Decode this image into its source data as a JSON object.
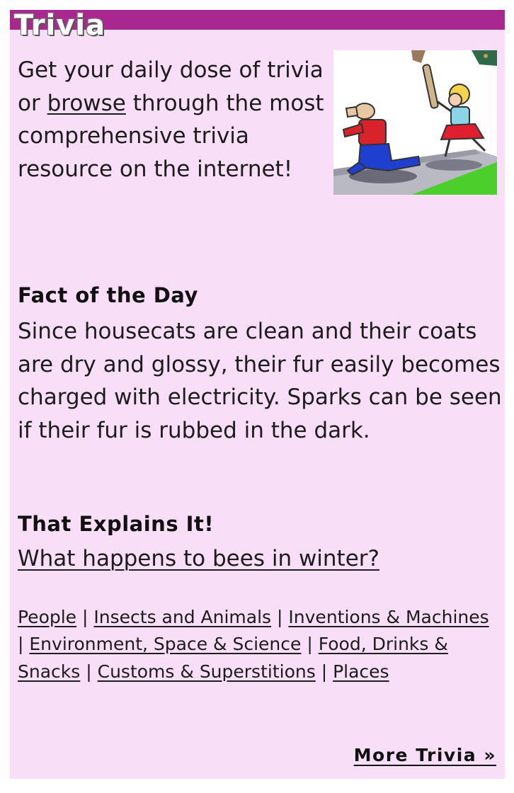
{
  "widget": {
    "title": "Trivia",
    "intro": {
      "text_before": "Get your daily dose of trivia or ",
      "link": "browse",
      "text_after": " through the most comprehensive trivia resource on the internet!"
    },
    "fact": {
      "heading": "Fact of the Day",
      "text": "Since housecats are clean and their coats are dry and glossy, their fur easily becomes charged with electricity. Sparks can be seen if their fur is rubbed in the dark."
    },
    "explains": {
      "heading": "That Explains It!",
      "link": "What happens to bees in winter?"
    },
    "categories": [
      "People",
      "Insects and Animals",
      "Inventions & Machines",
      "Environment, Space & Science",
      "Food, Drinks & Snacks",
      "Customs & Superstitions",
      "Places"
    ],
    "separator": "|",
    "more_link": "More Trivia »"
  },
  "colors": {
    "title_bar": "#a8288f",
    "panel_bg": "#f8def7",
    "text": "#1c1c1c"
  },
  "image": {
    "icon": "cartoon-chase-illustration"
  }
}
